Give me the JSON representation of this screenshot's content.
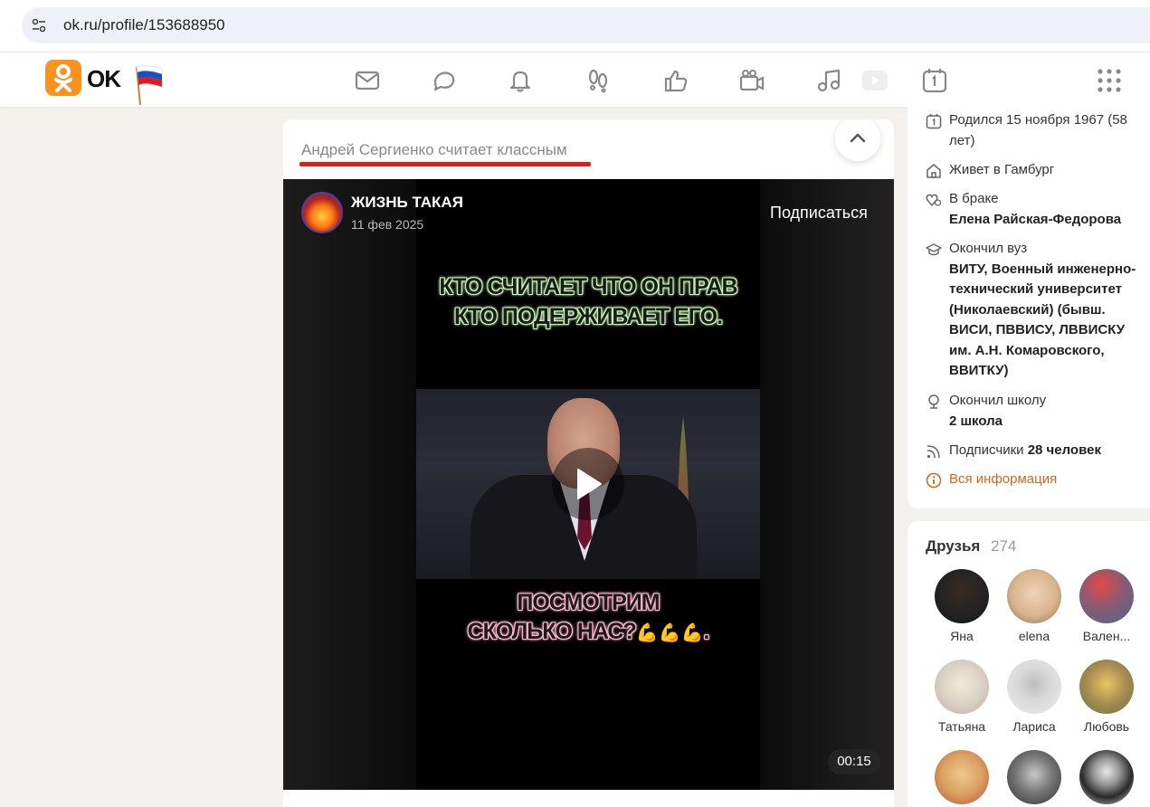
{
  "browser": {
    "url": "ok.ru/profile/153688950"
  },
  "header": {
    "logo_text": "OK",
    "brand_color": "#f7931e",
    "nav_icons": [
      "mail-icon",
      "chat-icon",
      "bell-icon",
      "guests-icon",
      "like-icon",
      "video-camera-icon",
      "music-icon",
      "video-play-icon",
      "calendar-icon"
    ]
  },
  "post": {
    "liked_by": "Андрей Сергиенко считает классным",
    "group_name": "ЖИЗНЬ ТАКАЯ",
    "date": "11 фев 2025",
    "subscribe_label": "Подписаться",
    "caption_top": "КТО СЧИТАЕТ ЧТО ОН ПРАВ КТО ПОДЕРЖИВАЕТ ЕГО.",
    "caption_bottom_1": "ПОСМОТРИМ",
    "caption_bottom_2": "СКОЛЬКО НАС?",
    "caption_bottom_end": ".",
    "duration": "00:15"
  },
  "profile_info": {
    "born": "Родился 15 ноября 1967 (58 лет)",
    "lives_label": "Живет в Гамбург",
    "marriage_label": "В браке",
    "spouse": "Елена Райская-Федорова",
    "university_label": "Окончил вуз",
    "university": "ВИТУ, Военный инженерно-технический университет (Николаевский) (бывш. ВИСИ, ПВВИСУ, ЛВВИСКУ им. А.Н. Комаровского, ВВИТКУ)",
    "school_label": "Окончил школу",
    "school": "2 школа",
    "subscribers_label": "Подписчики",
    "subscribers": "28 человек",
    "all_info": "Вся информация"
  },
  "friends": {
    "title": "Друзья",
    "count": "274",
    "items": [
      {
        "name": "Яна",
        "color": "#2a2a2a"
      },
      {
        "name": "elena",
        "color": "#d9b58e"
      },
      {
        "name": "Вален...",
        "color": "#8a5a72"
      },
      {
        "name": "Татьяна",
        "color": "#d8cfc4"
      },
      {
        "name": "Лариса",
        "color": "#e6e6e6"
      },
      {
        "name": "Любовь",
        "color": "#a88a52"
      },
      {
        "name": "",
        "color": "#d9a060"
      },
      {
        "name": "",
        "color": "#555555"
      },
      {
        "name": "",
        "color": "#3a3a3a"
      }
    ]
  }
}
